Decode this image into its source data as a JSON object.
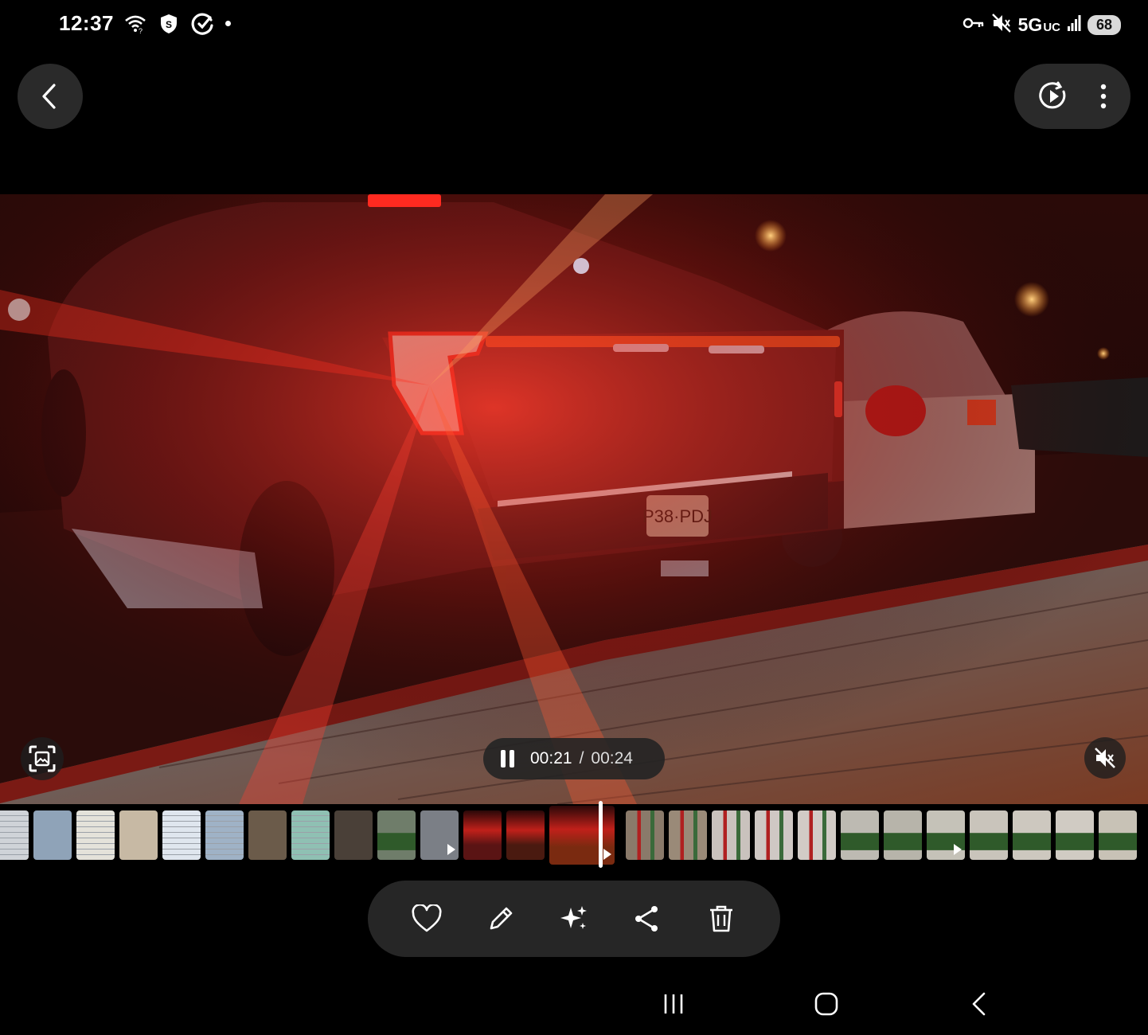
{
  "status_bar": {
    "time": "12:37",
    "network": "5G",
    "network_sub": "UC",
    "battery": "68",
    "icons": [
      "wifi-icon",
      "shield-icon",
      "sync-icon",
      "notification-dot",
      "vpn-key-icon",
      "mute-icon",
      "signal-icon",
      "battery-icon"
    ]
  },
  "top_bar": {
    "back_icon": "chevron-left-icon",
    "right_icons": [
      "motion-photo-play-icon",
      "more-options-icon"
    ]
  },
  "video": {
    "current_time": "00:21",
    "separator": "/",
    "total_time": "00:24",
    "state": "playing",
    "progress": 0.875
  },
  "overlay_icons": {
    "left": "image-scan-icon",
    "right": "volume-muted-icon"
  },
  "filmstrip": {
    "selected_index": 13,
    "thumbnails": [
      {
        "kind": "document",
        "color": "#cfd3d8",
        "video": false
      },
      {
        "kind": "photo",
        "color": "#8fa3b8",
        "video": false
      },
      {
        "kind": "document",
        "color": "#e4e2da",
        "video": false
      },
      {
        "kind": "card",
        "color": "#c7b9a4",
        "video": false
      },
      {
        "kind": "document",
        "color": "#dfe6ee",
        "video": false
      },
      {
        "kind": "document",
        "color": "#9fb2c6",
        "video": false
      },
      {
        "kind": "photo",
        "color": "#6b5b4a",
        "video": false
      },
      {
        "kind": "note",
        "color": "#8fc0b3",
        "video": false
      },
      {
        "kind": "photo",
        "color": "#4a4038",
        "video": false
      },
      {
        "kind": "tree",
        "color": "#6f7d6a",
        "video": false
      },
      {
        "kind": "selfie",
        "color": "#7b7f86",
        "video": true
      },
      {
        "kind": "car",
        "color": "#5a1414",
        "video": false
      },
      {
        "kind": "car",
        "color": "#4a1a10",
        "video": false
      },
      {
        "kind": "car",
        "color": "#7a2a10",
        "video": true
      },
      {
        "kind": "people",
        "color": "#8a7a6a",
        "video": false
      },
      {
        "kind": "people",
        "color": "#9a8a78",
        "video": false
      },
      {
        "kind": "people",
        "color": "#c9c2bd",
        "video": false
      },
      {
        "kind": "people",
        "color": "#cfc8c4",
        "video": false
      },
      {
        "kind": "people",
        "color": "#d2cbc6",
        "video": false
      },
      {
        "kind": "tree",
        "color": "#bdbab2",
        "video": false
      },
      {
        "kind": "tree",
        "color": "#b7b4aa",
        "video": false
      },
      {
        "kind": "tree",
        "color": "#c5c2b8",
        "video": true
      },
      {
        "kind": "tree",
        "color": "#c9c4bb",
        "video": false
      },
      {
        "kind": "tree",
        "color": "#cdc8bf",
        "video": false
      },
      {
        "kind": "tree",
        "color": "#d0cbc3",
        "video": false
      },
      {
        "kind": "tree",
        "color": "#c8c2b6",
        "video": false
      }
    ]
  },
  "actions": [
    "favorite-icon",
    "edit-icon",
    "ai-enhance-icon",
    "share-icon",
    "delete-icon"
  ],
  "navbar": [
    "recent-apps-icon",
    "home-icon",
    "back-nav-icon"
  ],
  "colors": {
    "background": "#000000",
    "pill": "#262626",
    "taillight": "#ff3020",
    "white": "#ffffff"
  }
}
